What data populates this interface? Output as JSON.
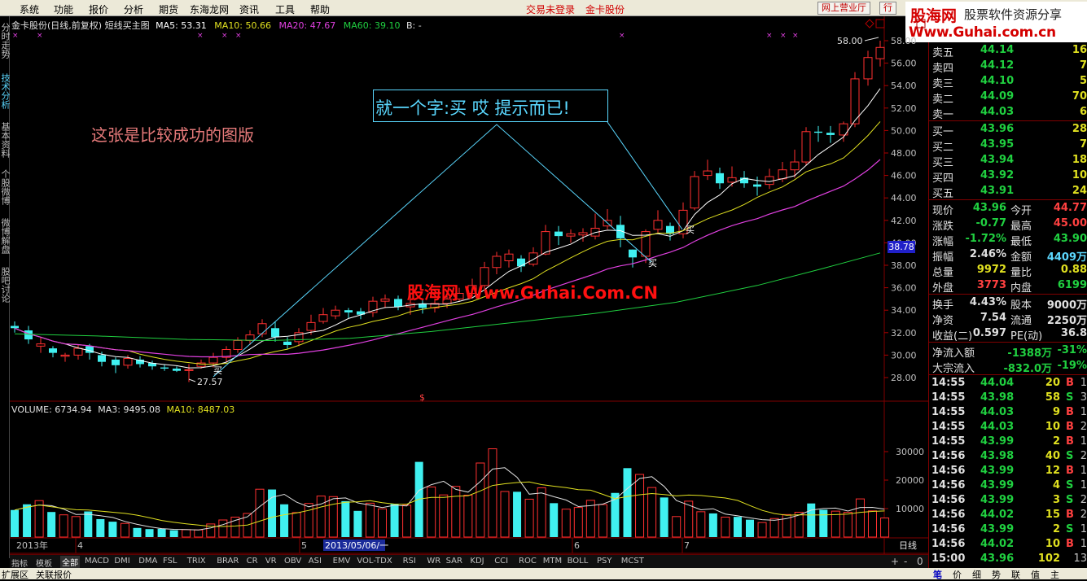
{
  "menu": {
    "items": [
      "系统",
      "功能",
      "报价",
      "分析",
      "期货",
      "东海龙网",
      "资讯",
      "工具",
      "帮助"
    ],
    "login_status": "交易未登录",
    "stock_label": "金卡股份",
    "online_hall": "网上营业厅",
    "trade": "行"
  },
  "logo": {
    "line1": "股海网",
    "line1b": "股票软件资源分享",
    "line2": "Www.Guhai.com.cn"
  },
  "left_tabs": [
    "分时走势",
    "技术分析",
    "基本资料",
    "个股微博",
    "微博解盘",
    "股吧讨论"
  ],
  "chart_header": {
    "title": "金卡股份(日线,前复权) 短线买主图",
    "ma5": "MA5: 53.31",
    "ma10": "MA10: 50.66",
    "ma20": "MA20: 47.67",
    "ma60": "MA60: 39.10",
    "b": "B: -"
  },
  "volume_header": {
    "volume": "VOLUME: 6734.94",
    "ma3": "MA3: 9495.08",
    "ma10": "MA10: 8487.03"
  },
  "annotations": {
    "note": "就一个字:买 哎 提示而已!",
    "caption": "这张是比较成功的图版",
    "watermark": "股海网 Www.Guhai.Com.CN",
    "high_label": "58.00",
    "low_label": "27.57",
    "buy_signal": "买",
    "s_marker": "$",
    "current_price_label": "38.78"
  },
  "price_axis": [
    "58.00",
    "56.00",
    "54.00",
    "52.00",
    "50.00",
    "48.00",
    "46.00",
    "44.00",
    "42.00",
    "40.00",
    "38.00",
    "36.00",
    "34.00",
    "32.00",
    "30.00",
    "28.00"
  ],
  "volume_axis": [
    "30000",
    "20000",
    "10000"
  ],
  "date_axis": {
    "year": "2013年",
    "m4": "4",
    "m5": "5",
    "cursor": "2013/05/06/一",
    "m6": "6",
    "m7": "7",
    "period": "日线"
  },
  "indicator_tabs": [
    "指标",
    "模板",
    "全部",
    "MACD",
    "DMI",
    "DMA",
    "FSL",
    "TRIX",
    "BRAR",
    "CR",
    "VR",
    "OBV",
    "ASI",
    "EMV",
    "VOL-TDX",
    "RSI",
    "WR",
    "SAR",
    "KDJ",
    "CCI",
    "ROC",
    "MTM",
    "BOLL",
    "PSY",
    "MCST"
  ],
  "indicator_tools": [
    "+",
    "-",
    "0"
  ],
  "status": {
    "expand": "扩展区",
    "linked_quote": "关联报价"
  },
  "order_book": {
    "sell": [
      {
        "label": "卖五",
        "price": "44.14",
        "vol": "16"
      },
      {
        "label": "卖四",
        "price": "44.12",
        "vol": "7"
      },
      {
        "label": "卖三",
        "price": "44.10",
        "vol": "5"
      },
      {
        "label": "卖二",
        "price": "44.09",
        "vol": "70"
      },
      {
        "label": "卖一",
        "price": "44.03",
        "vol": "6"
      }
    ],
    "buy": [
      {
        "label": "买一",
        "price": "43.96",
        "vol": "28"
      },
      {
        "label": "买二",
        "price": "43.95",
        "vol": "7"
      },
      {
        "label": "买三",
        "price": "43.94",
        "vol": "18"
      },
      {
        "label": "买四",
        "price": "43.92",
        "vol": "10"
      },
      {
        "label": "买五",
        "price": "43.91",
        "vol": "24"
      }
    ]
  },
  "quote": [
    {
      "l1": "现价",
      "v1": "43.96",
      "c1": "#20d040",
      "l2": "今开",
      "v2": "44.77",
      "c2": "#ff4040"
    },
    {
      "l1": "涨跌",
      "v1": "-0.77",
      "c1": "#20d040",
      "l2": "最高",
      "v2": "45.00",
      "c2": "#ff4040"
    },
    {
      "l1": "涨幅",
      "v1": "-1.72%",
      "c1": "#20d040",
      "l2": "最低",
      "v2": "43.90",
      "c2": "#20d040"
    },
    {
      "l1": "振幅",
      "v1": "2.46%",
      "c1": "#e0e0e0",
      "l2": "金额",
      "v2": "4409万",
      "c2": "#5cd8ff"
    },
    {
      "l1": "总量",
      "v1": "9972",
      "c1": "#e0e020",
      "l2": "量比",
      "v2": "0.88",
      "c2": "#e0e020"
    },
    {
      "l1": "外盘",
      "v1": "3773",
      "c1": "#ff4040",
      "l2": "内盘",
      "v2": "6199",
      "c2": "#20d040"
    }
  ],
  "fundamentals": [
    {
      "l1": "换手",
      "v1": "4.43%",
      "l2": "股本",
      "v2": "9000万"
    },
    {
      "l1": "净资",
      "v1": "7.54",
      "l2": "流通",
      "v2": "2250万"
    },
    {
      "l1": "收益(二)",
      "v1": "0.597",
      "l2": "PE(动)",
      "v2": "36.8"
    }
  ],
  "flows": [
    {
      "label": "净流入额",
      "value": "-1388万",
      "pct": "-31%"
    },
    {
      "label": "大宗流入",
      "value": "-832.0万",
      "pct": "-19%"
    }
  ],
  "ticks": [
    {
      "time": "14:55",
      "price": "44.04",
      "vol": "20",
      "side": "B",
      "n": "1"
    },
    {
      "time": "14:55",
      "price": "43.98",
      "vol": "58",
      "side": "S",
      "n": "3"
    },
    {
      "time": "14:55",
      "price": "44.03",
      "vol": "9",
      "side": "B",
      "n": "1"
    },
    {
      "time": "14:55",
      "price": "44.03",
      "vol": "10",
      "side": "B",
      "n": "2"
    },
    {
      "time": "14:55",
      "price": "43.99",
      "vol": "2",
      "side": "B",
      "n": "1"
    },
    {
      "time": "14:56",
      "price": "43.98",
      "vol": "40",
      "side": "S",
      "n": "2"
    },
    {
      "time": "14:56",
      "price": "43.99",
      "vol": "12",
      "side": "B",
      "n": "1"
    },
    {
      "time": "14:56",
      "price": "43.99",
      "vol": "4",
      "side": "S",
      "n": "1"
    },
    {
      "time": "14:56",
      "price": "43.99",
      "vol": "3",
      "side": "S",
      "n": "2"
    },
    {
      "time": "14:56",
      "price": "44.02",
      "vol": "15",
      "side": "B",
      "n": "2"
    },
    {
      "time": "14:56",
      "price": "43.99",
      "vol": "2",
      "side": "S",
      "n": "1"
    },
    {
      "time": "14:56",
      "price": "44.02",
      "vol": "10",
      "side": "B",
      "n": "1"
    },
    {
      "time": "15:00",
      "price": "43.96",
      "vol": "102",
      "side": "",
      "n": "13"
    }
  ],
  "right_tabs": [
    "笔",
    "价",
    "细",
    "势",
    "联",
    "值",
    "主"
  ],
  "colors": {
    "up": "#ff3030",
    "down": "#40f0f0",
    "ma5": "#ffffff",
    "ma10": "#e0e020",
    "ma20": "#e040e0",
    "ma60": "#20d040"
  }
}
